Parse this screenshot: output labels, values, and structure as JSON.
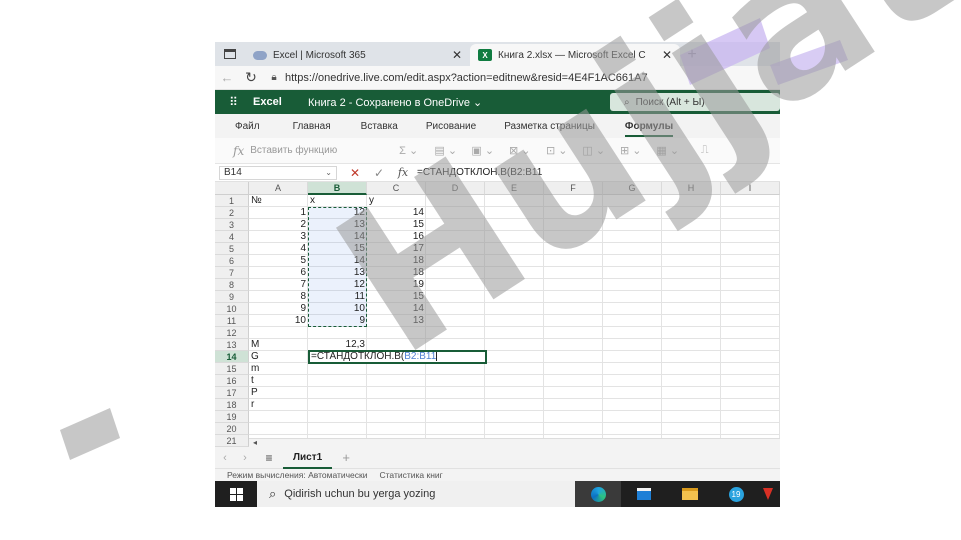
{
  "browser": {
    "tabs": [
      {
        "title": "Excel | Microsoft 365",
        "active": false
      },
      {
        "title": "Книга 2.xlsx — Microsoft Excel C",
        "active": true
      }
    ],
    "url": "https://onedrive.live.com/edit.aspx?action=editnew&resid=4E4F1AC661A7"
  },
  "excel": {
    "app_name": "Excel",
    "doc_status": "Книга 2 - Сохранено в OneDrive ⌄",
    "search_placeholder": "Поиск (Alt + Ы)",
    "ribbon_tabs": [
      "Файл",
      "Главная",
      "Вставка",
      "Рисование",
      "Разметка страницы",
      "Формулы"
    ],
    "active_ribbon_tab": "Формулы",
    "insert_function_label": "Вставить функцию",
    "name_box": "B14",
    "formula": "=СТАНДОТКЛОН.В(B2:B11"
  },
  "sheet": {
    "columns": [
      "A",
      "B",
      "C",
      "D",
      "E",
      "F",
      "G",
      "H",
      "I"
    ],
    "rows": [
      "1",
      "2",
      "3",
      "4",
      "5",
      "6",
      "7",
      "8",
      "9",
      "10",
      "11",
      "12",
      "13",
      "14",
      "15",
      "16",
      "17",
      "18",
      "19",
      "20",
      "21"
    ],
    "cells": {
      "A1": "№",
      "B1": "x",
      "C1": "y",
      "A2": "1",
      "B2": "12",
      "C2": "14",
      "A3": "2",
      "B3": "13",
      "C3": "15",
      "A4": "3",
      "B4": "14",
      "C4": "16",
      "A5": "4",
      "B5": "15",
      "C5": "17",
      "A6": "5",
      "B6": "14",
      "C6": "18",
      "A7": "6",
      "B7": "13",
      "C7": "18",
      "A8": "7",
      "B8": "12",
      "C8": "19",
      "A9": "8",
      "B9": "11",
      "C9": "15",
      "A10": "9",
      "B10": "10",
      "C10": "14",
      "A11": "10",
      "B11": "9",
      "C11": "13",
      "A13": "M",
      "B13": "12,3",
      "A14": "G",
      "A15": "m",
      "A16": "t",
      "A17": "P",
      "A18": "r"
    },
    "edit_cell_prefix": "=СТАНДОТКЛОН.В(",
    "edit_cell_ref": "B2:B11",
    "sheet_tab": "Лист1"
  },
  "status": {
    "calc_mode": "Режим вычисления: Автоматически",
    "workbook_stats": "Статистика книг"
  },
  "taskbar": {
    "search_text": "Qidirish uchun bu yerga yozing",
    "telegram_badge": "19"
  },
  "watermark": {
    "text": "Hujjat"
  }
}
